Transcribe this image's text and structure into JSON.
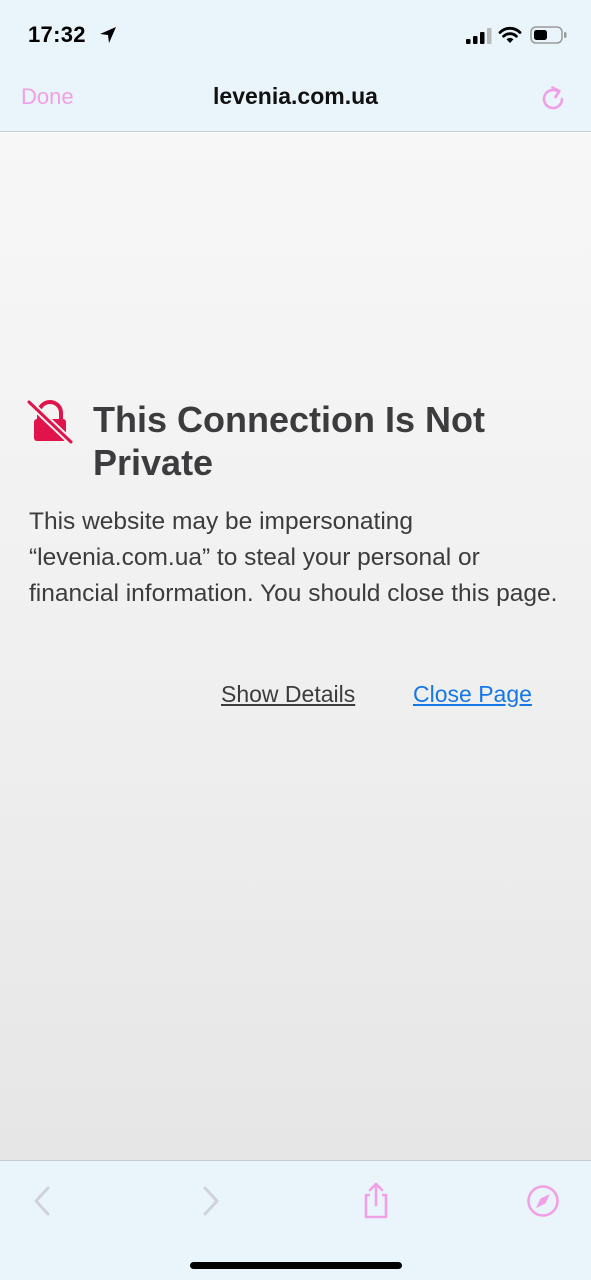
{
  "status_bar": {
    "time": "17:32",
    "icons": [
      "location-arrow-icon",
      "cell-signal-icon",
      "wifi-icon",
      "battery-icon"
    ]
  },
  "nav": {
    "done_label": "Done",
    "title": "levenia.com.ua",
    "reload_icon": "reload-icon"
  },
  "warning": {
    "icon": "lock-slash-icon",
    "title": "This Connection Is Not Private",
    "body": "This website may be impersonating “levenia.com.ua” to steal your personal or financial information. You should close this page.",
    "show_details_label": "Show Details",
    "close_page_label": "Close Page"
  },
  "toolbar": {
    "icons": [
      "back-chevron-icon",
      "forward-chevron-icon",
      "share-icon",
      "compass-icon"
    ]
  },
  "colors": {
    "accent_pink": "#f0a0e6",
    "link_blue": "#1677e6",
    "warning_red": "#e0134a",
    "bar_background": "#eaf5fb",
    "text_dark": "#3c3c3e"
  }
}
